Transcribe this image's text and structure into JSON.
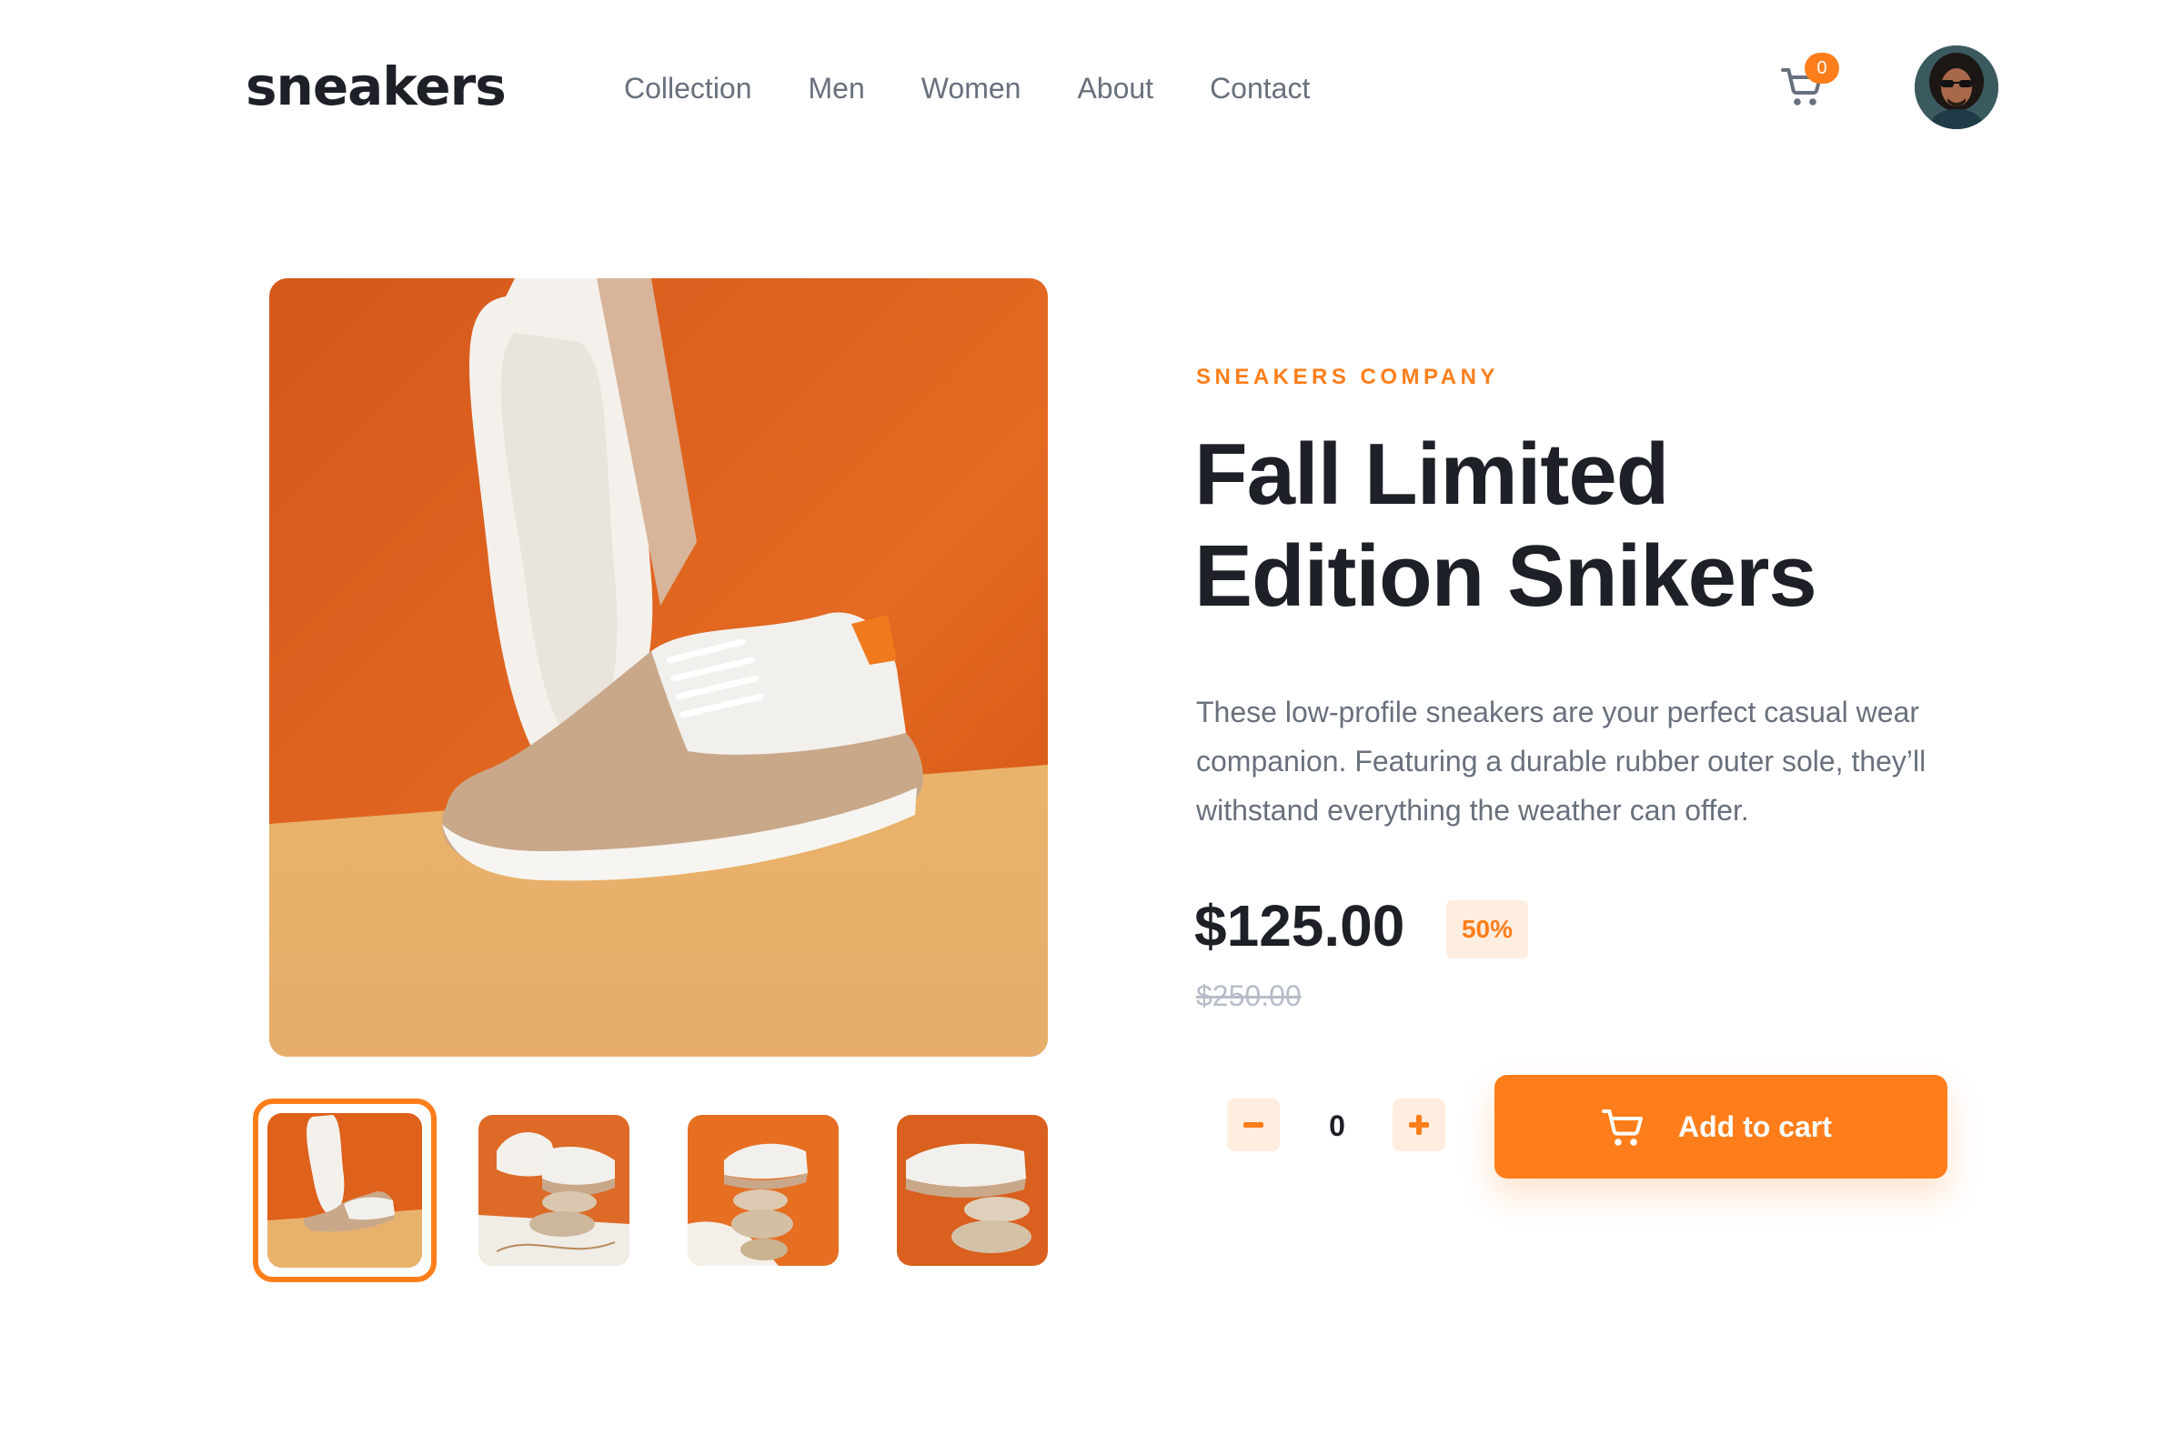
{
  "header": {
    "logo": "sneakers",
    "nav": [
      "Collection",
      "Men",
      "Women",
      "About",
      "Contact"
    ],
    "cart_count": "0",
    "icons": {
      "cart": "cart-icon",
      "avatar": "user-avatar"
    }
  },
  "gallery": {
    "thumbnails": 4,
    "active_thumbnail": 1
  },
  "product": {
    "company": "SNEAKERS COMPANY",
    "title_line1": "Fall Limited",
    "title_line2": "Edition Snikers",
    "description": "These low-profile sneakers are your perfect casual wear companion. Featuring a durable rubber outer sole, they’ll withstand everything the weather can offer.",
    "price": "$125.00",
    "discount": "50%",
    "old_price": "$250.00"
  },
  "cart_controls": {
    "quantity": "0",
    "add_to_cart_label": "Add to cart"
  },
  "colors": {
    "accent": "#ff7e1b",
    "accent_pale": "#ffede0",
    "text_dark": "#1d2026",
    "text_grey": "#69707d",
    "text_light": "#b6bcc8"
  }
}
